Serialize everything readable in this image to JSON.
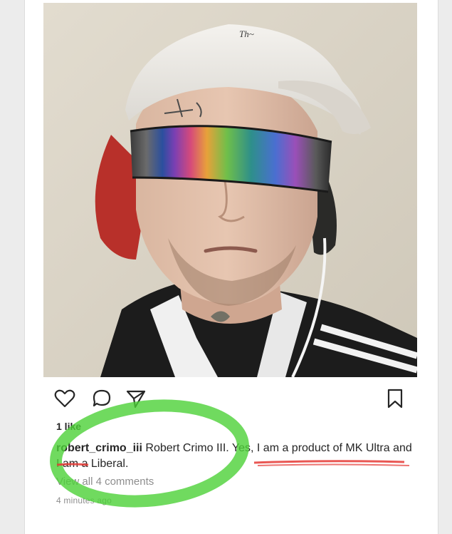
{
  "post": {
    "likes_text": "1 like",
    "caption": {
      "username": "robert_crimo_iii",
      "text": "Robert Crimo III. Yes, I am a product of MK Ultra and I am a Liberal."
    },
    "view_comments_text": "View all 4 comments",
    "timestamp": "4 minutes ago",
    "cap_logo_text": "Th~"
  },
  "icons": {
    "like": "heart-outline-icon",
    "comment": "comment-bubble-icon",
    "share": "paper-plane-icon",
    "save": "bookmark-outline-icon"
  },
  "colors": {
    "text_primary": "#262626",
    "text_secondary": "#8e8e8e",
    "highlight_circle": "#4cd137",
    "underline_mark": "#e53935"
  }
}
